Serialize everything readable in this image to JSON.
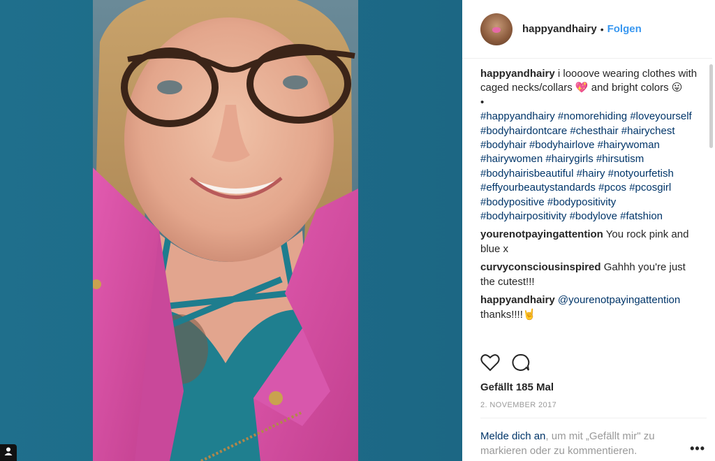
{
  "post": {
    "username": "happyandhairy",
    "separator": "•",
    "follow_label": "Folgen"
  },
  "caption": {
    "username": "happyandhairy",
    "text": " i loooove wearing clothes with caged necks/collars 💖 and bright colors 😛",
    "bullet": "•",
    "hashtags": "#happyandhairy #nomorehiding #loveyourself #bodyhairdontcare #chesthair #hairychest #bodyhair #bodyhairlove #hairywoman #hairywomen #hairygirls #hirsutism #bodyhairisbeautiful #hairy #notyourfetish #effyourbeautystandards #pcos #pcosgirl #bodypositive #bodypositivity #bodyhairpositivity #bodylove #fatshion"
  },
  "comments": [
    {
      "username": "yourenotpayingattention",
      "text": " You rock pink and blue x"
    },
    {
      "username": "curvyconsciousinspired",
      "text": " Gahhh you're just the cutest!!!"
    },
    {
      "username": "happyandhairy",
      "mention": " @yourenotpayingattention",
      "text": " thanks!!!!🤘"
    }
  ],
  "likes": "Gefällt 185 Mal",
  "date": "2. NOVEMBER 2017",
  "login_prompt": {
    "link": "Melde dich an",
    "rest": ", um mit „Gefällt mir\" zu markieren oder zu kommentieren."
  },
  "more_label": "•••",
  "icons": {
    "like": "heart-icon",
    "comment": "comment-bubble-icon",
    "options": "more-options-icon",
    "corner": "user-icon"
  },
  "colors": {
    "background": "#1d6a87",
    "link": "#3897f0",
    "hashtag": "#003569",
    "muted": "#999999",
    "jacket": "#d94fa6"
  }
}
